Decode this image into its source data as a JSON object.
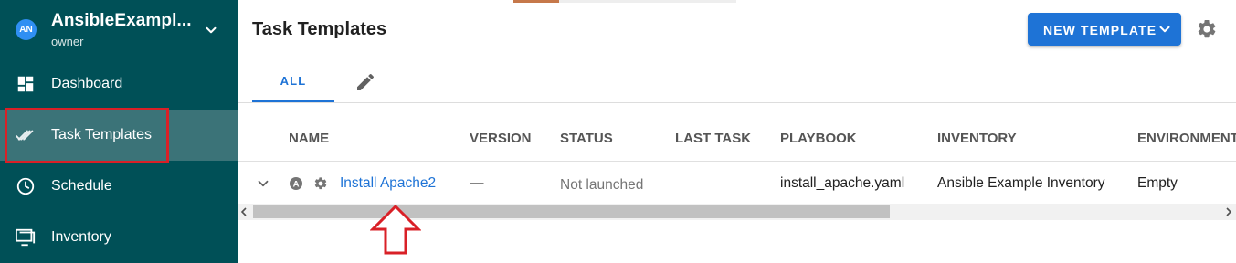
{
  "sidebar": {
    "avatar_initials": "AN",
    "project_name": "AnsibleExampl...",
    "project_role": "owner",
    "items": [
      {
        "label": "Dashboard",
        "icon": "dashboard-icon"
      },
      {
        "label": "Task Templates",
        "icon": "double-check-icon",
        "active": true
      },
      {
        "label": "Schedule",
        "icon": "clock-icon"
      },
      {
        "label": "Inventory",
        "icon": "monitor-icon"
      }
    ]
  },
  "header": {
    "title": "Task Templates",
    "new_template_label": "NEW TEMPLATE"
  },
  "tabs": {
    "all_label": "ALL"
  },
  "table": {
    "columns": [
      "NAME",
      "VERSION",
      "STATUS",
      "LAST TASK",
      "PLAYBOOK",
      "INVENTORY",
      "ENVIRONMENT"
    ],
    "rows": [
      {
        "app_initial": "A",
        "name": "Install Apache2",
        "version": "—",
        "status": "Not launched",
        "last_task": "",
        "playbook": "install_apache.yaml",
        "inventory": "Ansible Example Inventory",
        "environment": "Empty"
      }
    ]
  },
  "colors": {
    "sidebar_bg": "#005057",
    "active_item_bg": "#3b7378",
    "accent": "#1e73d6",
    "highlight_red": "#d92027"
  }
}
